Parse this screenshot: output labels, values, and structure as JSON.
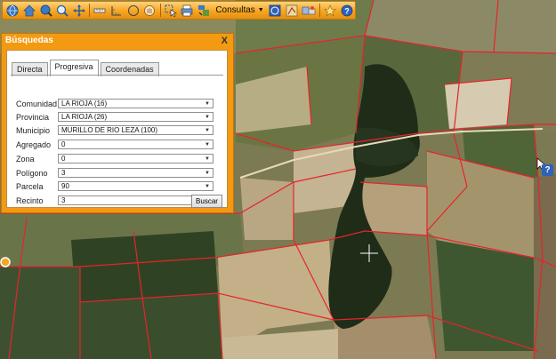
{
  "toolbar": {
    "consultas_label": "Consultas",
    "icons": [
      "globe-icon",
      "home-icon",
      "globe-zoom-icon",
      "zoom-icon",
      "pan-icon",
      "measure-line-icon",
      "measure-area-icon",
      "circle-icon",
      "hand-icon",
      "select-icon",
      "print-icon",
      "layers-icon",
      "info-icon",
      "map-icon",
      "tools-icon",
      "star-icon",
      "help-icon"
    ]
  },
  "dialog": {
    "title": "Búsquedas",
    "close_label": "X",
    "tabs": [
      {
        "label": "Directa"
      },
      {
        "label": "Progresiva",
        "active": true
      },
      {
        "label": "Coordenadas"
      }
    ],
    "fields": [
      {
        "label": "Comunidad",
        "value": "LA RIOJA (16)"
      },
      {
        "label": "Provincia",
        "value": "LA RIOJA (26)"
      },
      {
        "label": "Municipio",
        "value": "MURILLO DE RIO LEZA (100)"
      },
      {
        "label": "Agregado",
        "value": "0"
      },
      {
        "label": "Zona",
        "value": "0"
      },
      {
        "label": "Polígono",
        "value": "3"
      },
      {
        "label": "Parcela",
        "value": "90"
      },
      {
        "label": "Recinto",
        "value": "3"
      }
    ],
    "search_button": "Buscar"
  },
  "map": {
    "help_icon": "?"
  },
  "colors": {
    "toolbar": "#f5a623",
    "dialog_frame": "#f39a12",
    "parcel_border": "#e8232b"
  }
}
